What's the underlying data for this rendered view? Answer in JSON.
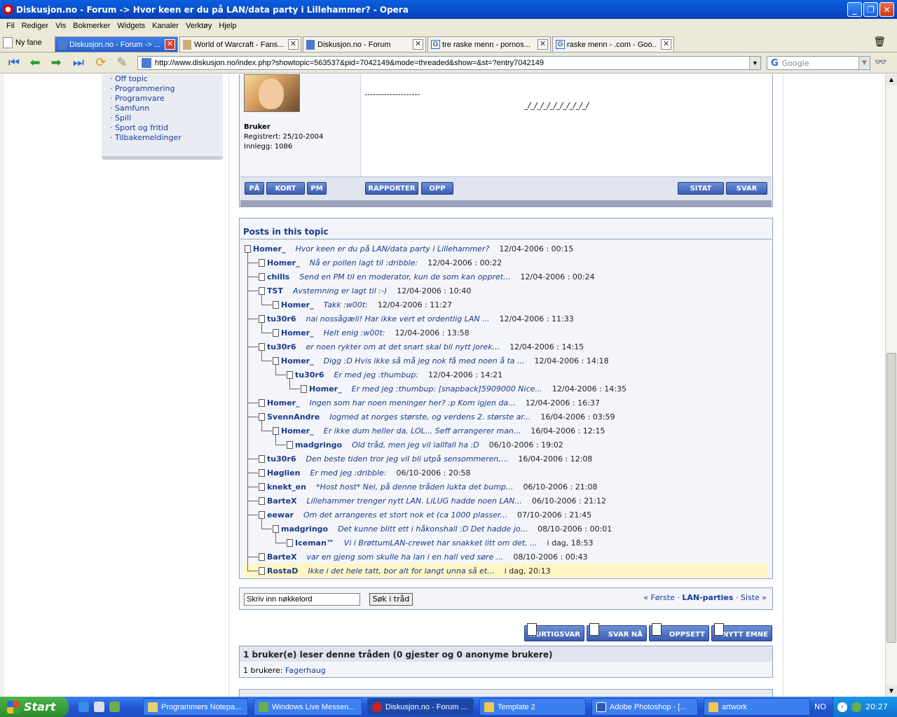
{
  "window": {
    "title": "Diskusjon.no - Forum -> Hvor keen er du på LAN/data party i Lillehammer? - Opera"
  },
  "menu": [
    "Fil",
    "Rediger",
    "Vis",
    "Bokmerker",
    "Widgets",
    "Kanaler",
    "Verktøy",
    "Hjelp"
  ],
  "newtab_label": "Ny fane",
  "tabs": [
    {
      "title": "Diskusjon.no - Forum -> ..."
    },
    {
      "title": "World of Warcraft - Fans..."
    },
    {
      "title": "Diskusjon.no - Forum"
    },
    {
      "title": "tre raske menn - pornos..."
    },
    {
      "title": "raske menn - .com - Goo..."
    }
  ],
  "address": {
    "url": "http://www.diskusjon.no/index.php?showtopic=563537&pid=7042149&mode=threaded&show=&st=?entry7042149"
  },
  "search": {
    "placeholder": "Google",
    "logo": "G"
  },
  "sidebar": {
    "links": [
      "· Off topic",
      "· Programmering",
      "· Programvare",
      "· Samfunn",
      "· Spill",
      "· Sport og fritid",
      "· Tilbakemeldinger"
    ]
  },
  "post": {
    "role": "Bruker",
    "registered": "Registrert: 25/10-2004",
    "posts": "Innlegg: 1086",
    "sig_line": "--------------------",
    "sig_text": "_/_/_/_/_/_/_/_/_/_/",
    "buttons_left": [
      "PÅ",
      "KORT",
      "PM"
    ],
    "buttons_mid": [
      "RAPPORTER",
      "OPP"
    ],
    "buttons_right": [
      "SITAT",
      "SVAR"
    ]
  },
  "topic": {
    "header": "Posts in this topic",
    "rows": [
      {
        "author": "Homer_",
        "excerpt": "Hvor keen er du på LAN/data party i Lillehammer?",
        "date": "12/04-2006 : 00:15",
        "depth": 0
      },
      {
        "author": "Homer_",
        "excerpt": "Nå er pollen lagt til :dribble:",
        "date": "12/04-2006 : 00:22",
        "depth": 1
      },
      {
        "author": "chills",
        "excerpt": "Send en PM til en moderator, kun de som kan oppret...",
        "date": "12/04-2006 : 00:24",
        "depth": 1
      },
      {
        "author": "TST",
        "excerpt": "Avstemning er lagt til :-)",
        "date": "12/04-2006 : 10:40",
        "depth": 1
      },
      {
        "author": "Homer_",
        "excerpt": "Takk :w00t:",
        "date": "12/04-2006 : 11:27",
        "depth": 2
      },
      {
        "author": "tu30r6",
        "excerpt": "nai nossågæli! Har ikke vert et ordentlig LAN ...",
        "date": "12/04-2006 : 11:33",
        "depth": 1
      },
      {
        "author": "Homer_",
        "excerpt": "Helt enig :w00t:",
        "date": "12/04-2006 : 13:58",
        "depth": 2
      },
      {
        "author": "tu30r6",
        "excerpt": "er noen rykter om at det snart skal bli nytt jorek...",
        "date": "12/04-2006 : 14:15",
        "depth": 1
      },
      {
        "author": "Homer_",
        "excerpt": "Digg :D Hvis ikke så må jeg nok få med noen å ta ...",
        "date": "12/04-2006 : 14:18",
        "depth": 2
      },
      {
        "author": "tu30r6",
        "excerpt": "Er med jeg :thumbup:",
        "date": "12/04-2006 : 14:21",
        "depth": 3
      },
      {
        "author": "Homer_",
        "excerpt": "Er med jeg :thumbup: [snapback]5909000 Nice...",
        "date": "12/04-2006 : 14:35",
        "depth": 4
      },
      {
        "author": "Homer_",
        "excerpt": "Ingen som har noen meninger her? :p Kom igjen da...",
        "date": "12/04-2006 : 16:37",
        "depth": 1
      },
      {
        "author": "SvennAndre",
        "excerpt": "Iogmed at norges største, og verdens 2. største ar...",
        "date": "16/04-2006 : 03:59",
        "depth": 1
      },
      {
        "author": "Homer_",
        "excerpt": "Er ikke dum heller da, LOL... Seff arrangerer man...",
        "date": "16/04-2006 : 12:15",
        "depth": 2
      },
      {
        "author": "madgringo",
        "excerpt": "Old tråd, men jeg vil iallfall ha :D",
        "date": "06/10-2006 : 19:02",
        "depth": 3
      },
      {
        "author": "tu30r6",
        "excerpt": "Den beste tiden tror jeg vil bli utpå sensommeren,...",
        "date": "16/04-2006 : 12:08",
        "depth": 1
      },
      {
        "author": "Høglien",
        "excerpt": "Er med jeg :dribble:",
        "date": "06/10-2006 : 20:58",
        "depth": 1
      },
      {
        "author": "knekt_en",
        "excerpt": "*Host host* Nei, på denne tråden lukta det bump...",
        "date": "06/10-2006 : 21:08",
        "depth": 1
      },
      {
        "author": "BarteX",
        "excerpt": "Lillehammer trenger nytt LAN. LiLUG hadde noen LAN...",
        "date": "06/10-2006 : 21:12",
        "depth": 1
      },
      {
        "author": "eewar",
        "excerpt": "Om det arrangeres et stort nok et (ca 1000 plasser...",
        "date": "07/10-2006 : 21:45",
        "depth": 1
      },
      {
        "author": "madgringo",
        "excerpt": "Det kunne blitt ett i håkonshall :D Det hadde jo...",
        "date": "08/10-2006 : 00:01",
        "depth": 2
      },
      {
        "author": "Iceman™",
        "excerpt": "Vi i BrøttumLAN-crewet har snakket litt om det, ...",
        "date": "i dag, 18:53",
        "depth": 3
      },
      {
        "author": "BarteX",
        "excerpt": "var en gjeng som skulle ha lan i en hall ved søre ...",
        "date": "08/10-2006 : 00:43",
        "depth": 1
      },
      {
        "author": "RostaD",
        "excerpt": "Ikke i det hele tatt, bor alt for langt unna så et...",
        "date": "i dag, 20:13",
        "depth": 1,
        "highlight": true
      }
    ]
  },
  "search_thread": {
    "input_value": "Skriv inn nøkkelord",
    "button": "Søk i tråd",
    "prev": "« Første",
    "dot": " · ",
    "forum": "LAN-parties",
    "next": "Siste »"
  },
  "action_buttons": [
    "HURTIGSVAR",
    "SVAR NÅ",
    "OPPSETT",
    "NYTT EMNE"
  ],
  "readers": {
    "line1": "1 bruker(e) leser denne tråden (0 gjester og 0 anonyme brukere)",
    "prefix": "1 brukere: ",
    "user": "Fagerhaug"
  },
  "taskbar": {
    "start": "Start",
    "tasks": [
      "Programmers Notepa...",
      "Windows Live Messen...",
      "Diskusjon.no - Forum ...",
      "Template 2",
      "Adobe Photoshop - [...",
      "artwork"
    ],
    "lang": "NO",
    "clock": "20:27"
  }
}
